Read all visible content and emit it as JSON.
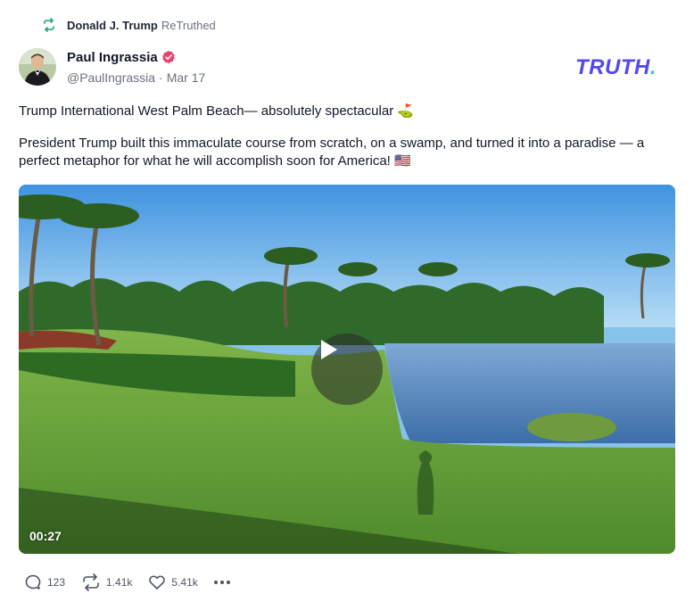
{
  "retruth": {
    "icon": "retruth-icon",
    "user": "Donald J. Trump",
    "suffix": "ReTruthed"
  },
  "author": {
    "name": "Paul Ingrassia",
    "handle": "@PaulIngrassia",
    "separator": "·",
    "date": "Mar 17",
    "verified_icon": "verified-badge-icon",
    "verified_color": "#e8436b"
  },
  "brand": {
    "text": "TRUTH",
    "period": ".",
    "color": "#5448ee",
    "accent": "#3ac7c0"
  },
  "post": {
    "line1": "Trump International West Palm Beach— absolutely spectacular ⛳",
    "line2": "President Trump built this immaculate course from scratch, on a swamp, and turned it into a paradise — a perfect metaphor for what he will accomplish soon for America! 🇺🇸"
  },
  "media": {
    "duration": "00:27",
    "play_icon": "play-icon"
  },
  "actions": {
    "replies": "123",
    "retruths": "1.41k",
    "likes": "5.41k",
    "reply_icon": "reply-icon",
    "retruth_icon": "retruth-icon",
    "like_icon": "heart-icon",
    "more_icon": "more-icon"
  }
}
